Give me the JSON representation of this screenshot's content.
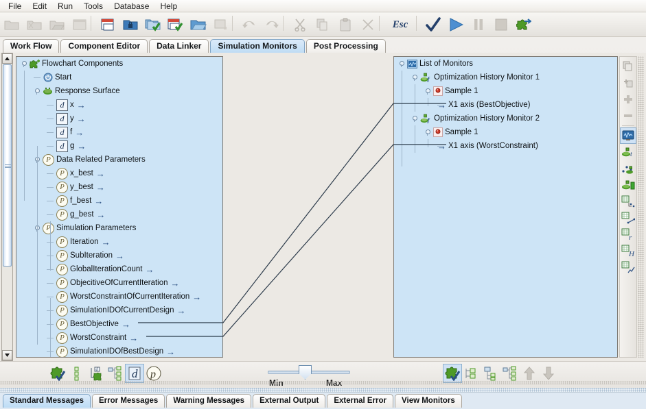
{
  "menu": {
    "items": [
      {
        "label": "File"
      },
      {
        "label": "Edit"
      },
      {
        "label": "Run"
      },
      {
        "label": "Tools"
      },
      {
        "label": "Database"
      },
      {
        "label": "Help"
      }
    ]
  },
  "toolbar": {
    "buttons": [
      {
        "name": "new-folder-icon",
        "label": "",
        "state": "disabled"
      },
      {
        "name": "new-document-icon",
        "label": "",
        "state": "disabled"
      },
      {
        "name": "open-folder-icon",
        "label": "",
        "state": "disabled"
      },
      {
        "name": "window-icon",
        "label": "",
        "state": "disabled"
      },
      {
        "name": "save-icon",
        "label": "",
        "state": "enabled"
      },
      {
        "name": "lock-folder-icon",
        "label": "",
        "state": "enabled"
      },
      {
        "name": "open-project-check-icon",
        "label": "",
        "state": "enabled"
      },
      {
        "name": "save-check-icon",
        "label": "",
        "state": "enabled"
      },
      {
        "name": "open-blue-folder-icon",
        "label": "",
        "state": "enabled"
      },
      {
        "name": "close-window-icon",
        "label": "",
        "state": "disabled"
      },
      {
        "name": "undo-icon",
        "label": "",
        "state": "disabled"
      },
      {
        "name": "redo-icon",
        "label": "",
        "state": "disabled"
      },
      {
        "name": "cut-icon",
        "label": "",
        "state": "disabled"
      },
      {
        "name": "copy-icon",
        "label": "",
        "state": "disabled"
      },
      {
        "name": "paste-icon",
        "label": "",
        "state": "disabled"
      },
      {
        "name": "delete-icon",
        "label": "",
        "state": "disabled"
      },
      {
        "name": "escape-icon",
        "label": "Esc",
        "state": "enabled"
      },
      {
        "name": "check-icon",
        "label": "",
        "state": "enabled"
      },
      {
        "name": "run-icon",
        "label": "",
        "state": "enabled"
      },
      {
        "name": "pause-icon",
        "label": "",
        "state": "disabled"
      },
      {
        "name": "stop-icon",
        "label": "",
        "state": "disabled"
      },
      {
        "name": "plugin-icon",
        "label": "",
        "state": "enabled"
      }
    ]
  },
  "tabs": {
    "items": [
      {
        "label": "Work Flow",
        "active": false
      },
      {
        "label": "Component Editor",
        "active": false
      },
      {
        "label": "Data Linker",
        "active": false
      },
      {
        "label": "Simulation Monitors",
        "active": true
      },
      {
        "label": "Post Processing",
        "active": false
      }
    ]
  },
  "left_tree": {
    "nodes": [
      {
        "label": "Flowchart Components",
        "indent": 0,
        "icon": "puzzle-green-icon",
        "expander": "expanded",
        "arrow": false
      },
      {
        "label": "Start",
        "indent": 1,
        "icon": "start-power-icon",
        "expander": "leaf",
        "arrow": false
      },
      {
        "label": "Response Surface",
        "indent": 1,
        "icon": "response-surface-icon",
        "expander": "expanded",
        "arrow": false
      },
      {
        "label": "x",
        "indent": 2,
        "icon": "datum-d-icon",
        "expander": "leaf",
        "arrow": true
      },
      {
        "label": "y",
        "indent": 2,
        "icon": "datum-d-icon",
        "expander": "leaf",
        "arrow": true
      },
      {
        "label": "f",
        "indent": 2,
        "icon": "datum-d-icon",
        "expander": "leaf",
        "arrow": true
      },
      {
        "label": "g",
        "indent": 2,
        "icon": "datum-d-icon",
        "expander": "leaf",
        "arrow": true
      },
      {
        "label": "Data Related Parameters",
        "indent": 1,
        "icon": "parameter-p-icon",
        "expander": "expanded",
        "arrow": false
      },
      {
        "label": "x_best",
        "indent": 2,
        "icon": "parameter-p-icon",
        "expander": "leaf",
        "arrow": true
      },
      {
        "label": "y_best",
        "indent": 2,
        "icon": "parameter-p-icon",
        "expander": "leaf",
        "arrow": true
      },
      {
        "label": "f_best",
        "indent": 2,
        "icon": "parameter-p-icon",
        "expander": "leaf",
        "arrow": true
      },
      {
        "label": "g_best",
        "indent": 2,
        "icon": "parameter-p-icon",
        "expander": "leaf",
        "arrow": true
      },
      {
        "label": "Simulation Parameters",
        "indent": 1,
        "icon": "parameter-p-icon",
        "expander": "expanded",
        "arrow": false
      },
      {
        "label": "Iteration",
        "indent": 2,
        "icon": "parameter-p-icon",
        "expander": "leaf",
        "arrow": true
      },
      {
        "label": "SubIteration",
        "indent": 2,
        "icon": "parameter-p-icon",
        "expander": "leaf",
        "arrow": true
      },
      {
        "label": "GlobalIterationCount",
        "indent": 2,
        "icon": "parameter-p-icon",
        "expander": "leaf",
        "arrow": true
      },
      {
        "label": "ObjecitiveOfCurrentIteration",
        "indent": 2,
        "icon": "parameter-p-icon",
        "expander": "leaf",
        "arrow": true
      },
      {
        "label": "WorstConstraintOfCurrentIteration",
        "indent": 2,
        "icon": "parameter-p-icon",
        "expander": "leaf",
        "arrow": true
      },
      {
        "label": "SimulationIDOfCurrentDesign",
        "indent": 2,
        "icon": "parameter-p-icon",
        "expander": "leaf",
        "arrow": true
      },
      {
        "label": "BestObjective",
        "indent": 2,
        "icon": "parameter-p-icon",
        "expander": "leaf",
        "arrow": true
      },
      {
        "label": "WorstConstraint",
        "indent": 2,
        "icon": "parameter-p-icon",
        "expander": "leaf",
        "arrow": true
      },
      {
        "label": "SimulationIDOfBestDesign",
        "indent": 2,
        "icon": "parameter-p-icon",
        "expander": "leaf",
        "arrow": true
      }
    ]
  },
  "right_tree": {
    "nodes": [
      {
        "label": "List of Monitors",
        "indent": 0,
        "icon": "monitor-list-icon",
        "expander": "expanded",
        "arrow": false
      },
      {
        "label": "Optimization History Monitor 1",
        "indent": 1,
        "icon": "history-monitor-icon",
        "expander": "expanded",
        "arrow": false
      },
      {
        "label": "Sample 1",
        "indent": 2,
        "icon": "sample-icon",
        "expander": "expanded",
        "arrow": false
      },
      {
        "label": "X1 axis (BestObjective)",
        "indent": 3,
        "icon": "axis-icon",
        "expander": "leaf",
        "arrow": true
      },
      {
        "label": "Optimization History Monitor 2",
        "indent": 1,
        "icon": "history-monitor-icon",
        "expander": "expanded",
        "arrow": false
      },
      {
        "label": "Sample 1",
        "indent": 2,
        "icon": "sample-icon",
        "expander": "expanded",
        "arrow": false
      },
      {
        "label": "X1 axis (WorstConstraint)",
        "indent": 3,
        "icon": "axis-icon",
        "expander": "leaf",
        "arrow": true
      }
    ]
  },
  "connections": [
    {
      "from": "BestObjective",
      "to": "X1 axis (BestObjective)"
    },
    {
      "from": "WorstConstraint",
      "to": "X1 axis (WorstConstraint)"
    }
  ],
  "right_toolbar": {
    "buttons": [
      {
        "name": "copy-pages-icon"
      },
      {
        "name": "add-page-icon"
      },
      {
        "name": "add-plus-icon"
      },
      {
        "name": "remove-minus-icon"
      },
      {
        "name": "monitor-scope-icon"
      },
      {
        "name": "sample-t-icon"
      },
      {
        "name": "scatter-sample-icon"
      },
      {
        "name": "sample-bar-icon"
      },
      {
        "name": "grid-point-icon"
      },
      {
        "name": "grid-line-icon"
      },
      {
        "name": "grid-r-icon"
      },
      {
        "name": "grid-h-icon"
      },
      {
        "name": "grid-trend-icon"
      }
    ]
  },
  "bottom_left_toolbar": {
    "buttons": [
      {
        "name": "puzzle-check-icon",
        "selected": false
      },
      {
        "name": "list-nodes-icon",
        "selected": false
      },
      {
        "name": "add-datum-icon",
        "selected": false
      },
      {
        "name": "tree-map-icon",
        "selected": false
      },
      {
        "name": "datum-d-filter-icon",
        "selected": true
      },
      {
        "name": "parameter-p-filter-icon",
        "selected": false
      }
    ]
  },
  "bottom_right_toolbar": {
    "buttons": [
      {
        "name": "puzzle-check-icon",
        "selected": true
      },
      {
        "name": "expand-tree-icon",
        "selected": false
      },
      {
        "name": "collapse-tree-icon",
        "selected": false
      },
      {
        "name": "tree-map-icon",
        "selected": false
      },
      {
        "name": "move-up-icon",
        "selected": false
      },
      {
        "name": "move-down-icon",
        "selected": false
      }
    ]
  },
  "slider": {
    "min_label": "Min",
    "max_label": "Max",
    "value_percent": 42
  },
  "bottom_tabs": {
    "items": [
      {
        "label": "Standard Messages",
        "active": true
      },
      {
        "label": "Error Messages",
        "active": false
      },
      {
        "label": "Warning Messages",
        "active": false
      },
      {
        "label": "External Output",
        "active": false
      },
      {
        "label": "External Error",
        "active": false
      },
      {
        "label": "View Monitors",
        "active": false
      }
    ]
  },
  "colors": {
    "panel_bg": "#cde4f6",
    "accent_tab": "#bfdcf4",
    "line": "#2b3a4a",
    "arrow": "#2a4f82",
    "green_icon": "#4e9a28"
  }
}
